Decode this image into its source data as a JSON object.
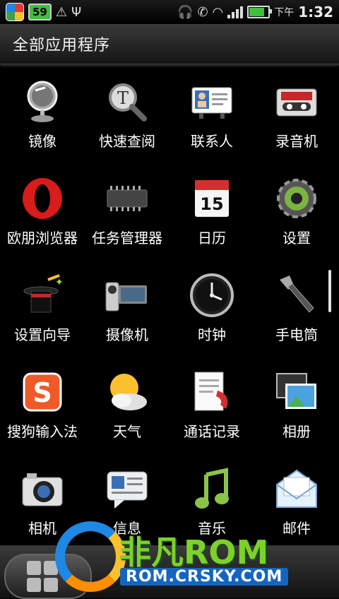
{
  "status_bar": {
    "battery_level": "59",
    "ampm": "下午",
    "time": "1:32"
  },
  "header": {
    "title": "全部应用程序"
  },
  "apps": [
    {
      "label": "镜像",
      "icon": "mirror-icon"
    },
    {
      "label": "快速查阅",
      "icon": "quick-lookup-icon"
    },
    {
      "label": "联系人",
      "icon": "contacts-icon"
    },
    {
      "label": "录音机",
      "icon": "voice-recorder-icon"
    },
    {
      "label": "欧朋浏览器",
      "icon": "opera-browser-icon"
    },
    {
      "label": "任务管理器",
      "icon": "task-manager-icon"
    },
    {
      "label": "日历",
      "icon": "calendar-icon"
    },
    {
      "label": "设置",
      "icon": "settings-gear-icon"
    },
    {
      "label": "设置向导",
      "icon": "setup-wizard-icon"
    },
    {
      "label": "摄像机",
      "icon": "camcorder-icon"
    },
    {
      "label": "时钟",
      "icon": "clock-icon"
    },
    {
      "label": "手电筒",
      "icon": "flashlight-icon"
    },
    {
      "label": "搜狗输入法",
      "icon": "sogou-input-icon"
    },
    {
      "label": "天气",
      "icon": "weather-icon"
    },
    {
      "label": "通话记录",
      "icon": "call-history-icon"
    },
    {
      "label": "相册",
      "icon": "gallery-icon"
    },
    {
      "label": "相机",
      "icon": "camera-icon"
    },
    {
      "label": "信息",
      "icon": "messages-icon"
    },
    {
      "label": "音乐",
      "icon": "music-icon"
    },
    {
      "label": "邮件",
      "icon": "mail-icon"
    }
  ],
  "calendar_day": "15",
  "watermark": {
    "title": "非凡ROM",
    "url": "ROM.CRSKY.COM"
  },
  "colors": {
    "background": "#000000",
    "watermark_green": "#7cd12b",
    "watermark_blue": "#1565c0"
  }
}
